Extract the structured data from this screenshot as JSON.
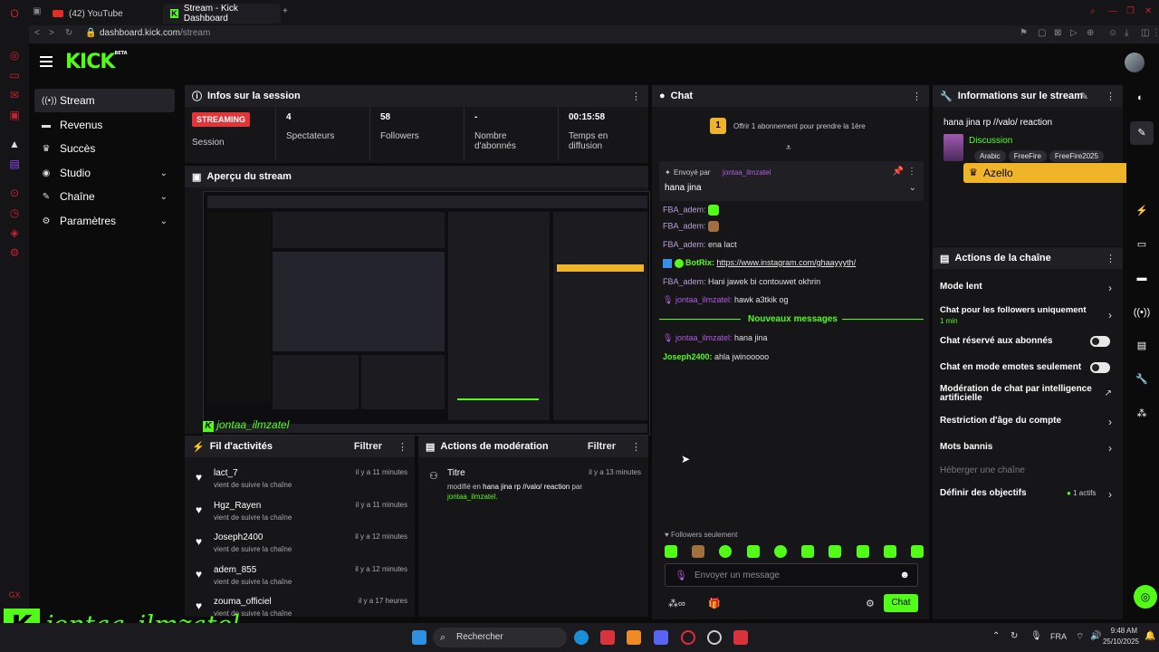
{
  "browser": {
    "tabs": [
      {
        "label": "(42) YouTube"
      },
      {
        "label": "Stream - Kick Dashboard"
      }
    ],
    "url_host": "dashboard.kick.com",
    "url_path": "/stream"
  },
  "header": {
    "logo": "KICK",
    "logo_sup": "BETA"
  },
  "sidebar": {
    "items": [
      {
        "label": "Stream"
      },
      {
        "label": "Revenus"
      },
      {
        "label": "Succès"
      },
      {
        "label": "Studio"
      },
      {
        "label": "Chaîne"
      },
      {
        "label": "Paramètres"
      }
    ]
  },
  "session": {
    "title": "Infos sur la session",
    "status_badge": "STREAMING",
    "status_label": "Session",
    "viewers_value": "4",
    "viewers_label": "Spectateurs",
    "followers_value": "58",
    "followers_label": "Followers",
    "subs_value": "-",
    "subs_label": "Nombre d'abonnés",
    "time_value": "00:15:58",
    "time_label": "Temps en diffusion"
  },
  "preview": {
    "title": "Aperçu du stream",
    "watermark": "jontaa_ilmzatel"
  },
  "activity": {
    "title": "Fil d'activités",
    "filter": "Filtrer",
    "items": [
      {
        "name": "lact_7",
        "sub": "vient de suivre la chaîne",
        "time": "il y a 11 minutes"
      },
      {
        "name": "Hgz_Rayen",
        "sub": "vient de suivre la chaîne",
        "time": "il y a 11 minutes"
      },
      {
        "name": "Joseph2400",
        "sub": "vient de suivre la chaîne",
        "time": "il y a 12 minutes"
      },
      {
        "name": "adem_855",
        "sub": "vient de suivre la chaîne",
        "time": "il y a 12 minutes"
      },
      {
        "name": "zouma_officiel",
        "sub": "vient de suivre la chaîne",
        "time": "il y a 17 heures"
      }
    ]
  },
  "moderation": {
    "title": "Actions de modération",
    "filter": "Filtrer",
    "item_title": "Titre",
    "item_time": "il y a 13 minutes",
    "item_line1_prefix": "modifié en",
    "item_line1_value": "hana jina rp //valo/ reaction",
    "item_line1_suffix": "par",
    "item_by": "jontaa_ilmzatel."
  },
  "chat": {
    "title": "Chat",
    "gift_text": "Offrir 1 abonnement pour prendre la 1ère",
    "gift_count": "1",
    "pinned_by_label": "Envoyé par",
    "pinned_by": "jontaa_ilmzatel",
    "pinned_text": "hana jina",
    "messages": [
      {
        "user": "FBA_adem:",
        "text": ""
      },
      {
        "user": "FBA_adem:",
        "text": ""
      },
      {
        "user": "FBA_adem:",
        "text": "ena lact"
      },
      {
        "user": "BotRix:",
        "text": "https://www.instagram.com/ghaayyyth/"
      },
      {
        "user": "FBA_adem:",
        "text": "Hani jawek bi contouwet okhrin"
      },
      {
        "user": "jontaa_ilmzatel:",
        "text": "hawk a3tkik og"
      }
    ],
    "new_messages_label": "Nouveaux messages",
    "new_messages": [
      {
        "user": "jontaa_ilmzatel:",
        "text": "hana jina"
      },
      {
        "user": "Joseph2400:",
        "text": "ahla jwinooooo"
      }
    ],
    "followers_only_label": "Followers seulement",
    "input_placeholder": "Envoyer un message",
    "send_label": "Chat"
  },
  "stream_info": {
    "title": "Informations sur le stream",
    "stream_title": "hana jina rp //valo/ reaction",
    "category": "Discussion",
    "tags": [
      "Arabic",
      "FreeFire",
      "FreeFire2025"
    ],
    "top_supporter": "Azello",
    "top_supporter_count": "10"
  },
  "channel_actions": {
    "title": "Actions de la chaîne",
    "items": [
      {
        "label": "Mode lent",
        "sub": ""
      },
      {
        "label": "Chat pour les followers uniquement",
        "sub": "1 min"
      },
      {
        "label": "Chat réservé aux abonnés",
        "sub": ""
      },
      {
        "label": "Chat en mode emotes seulement",
        "sub": ""
      },
      {
        "label": "Modération de chat par intelligence artificielle",
        "sub": ""
      },
      {
        "label": "Restriction d'âge du compte",
        "sub": ""
      },
      {
        "label": "Mots bannis",
        "sub": ""
      },
      {
        "label": "Héberger une chaîne",
        "sub": ""
      },
      {
        "label": "Définir des objectifs",
        "sub": "1 actifs"
      }
    ]
  },
  "overlay_watermark": "jontaa_ilmzatel",
  "taskbar": {
    "search_label": "Rechercher",
    "lang": "FRA",
    "time": "9:48 AM",
    "date": "25/10/2025"
  },
  "colors": {
    "accent": "#53fc18",
    "streaming": "#e2353a",
    "panel": "#161618",
    "panel_head": "#202024"
  }
}
